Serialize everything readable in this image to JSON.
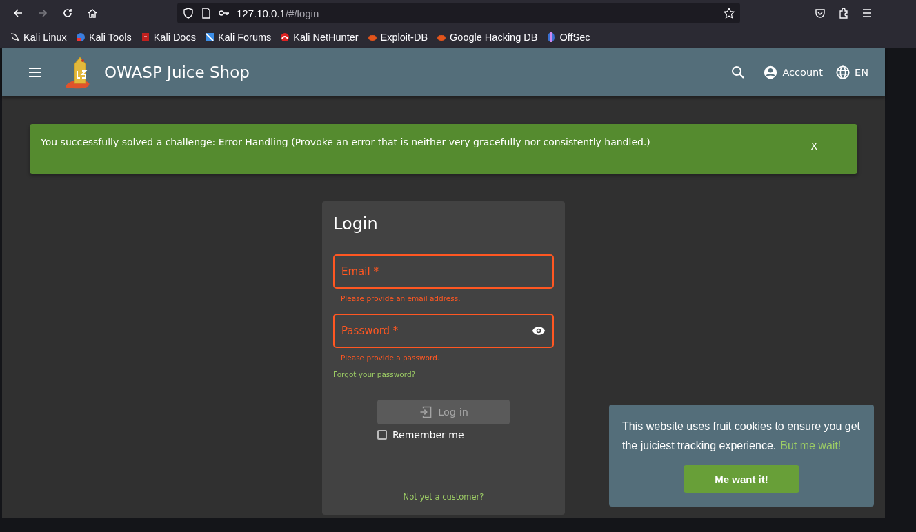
{
  "browser": {
    "nav": [
      {
        "kind": "back",
        "disabled": false
      },
      {
        "kind": "forward",
        "disabled": true
      },
      {
        "kind": "reload",
        "disabled": false
      },
      {
        "kind": "home",
        "disabled": false
      }
    ],
    "url_host": "127.10.0.1",
    "url_path": "/#/login",
    "bookmarks": [
      {
        "label": "Kali Linux",
        "kind": "dragon"
      },
      {
        "label": "Kali Tools",
        "kind": "tools"
      },
      {
        "label": "Kali Docs",
        "kind": "docs"
      },
      {
        "label": "Kali Forums",
        "kind": "forums"
      },
      {
        "label": "Kali NetHunter",
        "kind": "nethunter"
      },
      {
        "label": "Exploit-DB",
        "kind": "bug"
      },
      {
        "label": "Google Hacking DB",
        "kind": "bug"
      },
      {
        "label": "OffSec",
        "kind": "offsec"
      }
    ]
  },
  "header": {
    "title": "OWASP Juice Shop",
    "account": "Account",
    "language": "EN"
  },
  "snackbar": {
    "message": "You successfully solved a challenge: Error Handling (Provoke an error that is neither very gracefully nor consistently handled.)",
    "close": "X"
  },
  "login": {
    "title": "Login",
    "fields": [
      {
        "kind": "email",
        "placeholder": "Email *",
        "invalid": true,
        "error": "Please provide an email address."
      },
      {
        "kind": "password",
        "placeholder": "Password *",
        "invalid": true,
        "error": "Please provide a password."
      }
    ],
    "forgot": "Forgot your password?",
    "button": {
      "label": "Log in",
      "disabled": true
    },
    "remember": {
      "label": "Remember me",
      "checked": false
    },
    "register": "Not yet a customer?"
  },
  "cookie": {
    "message": "This website uses fruit cookies to ensure you get the juiciest tracking experience.",
    "link": "But me wait!",
    "button": "Me want it!"
  }
}
